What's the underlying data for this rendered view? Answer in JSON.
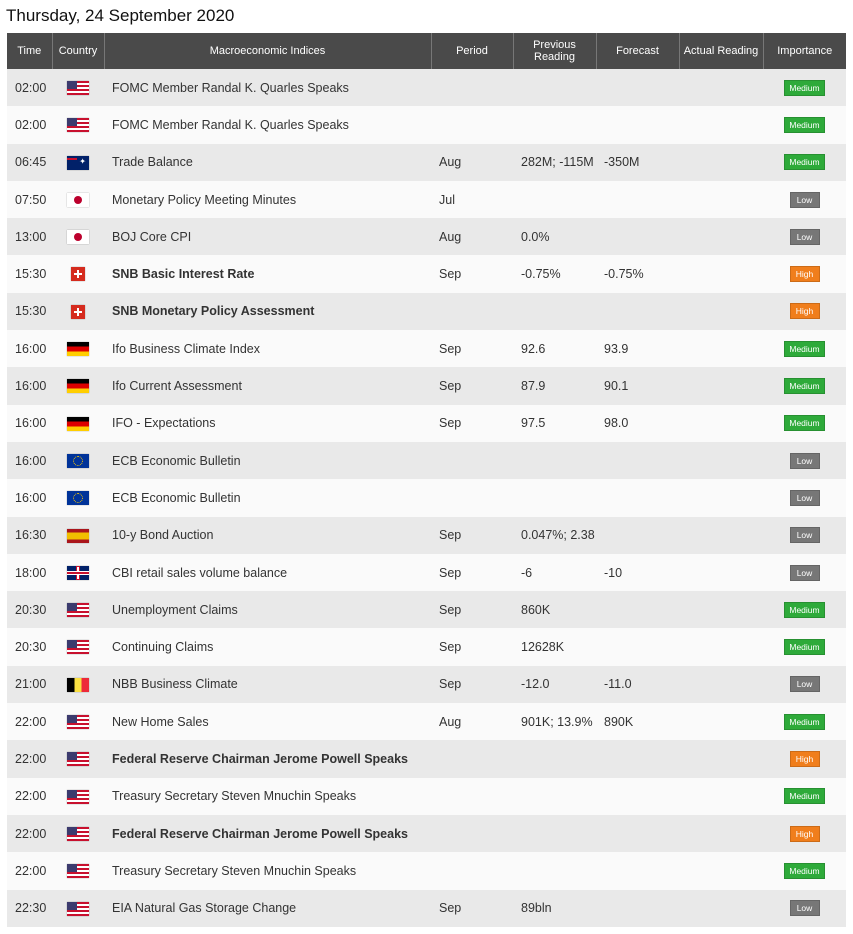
{
  "page_title": "Thursday, 24 September 2020",
  "headers": {
    "time": "Time",
    "country": "Country",
    "event": "Macroeconomic Indices",
    "period": "Period",
    "previous": "Previous Reading",
    "forecast": "Forecast",
    "actual": "Actual Reading",
    "importance": "Importance"
  },
  "importance_colors": {
    "Medium": "#2eaa3a",
    "Low": "#777777",
    "High": "#f07e1c"
  },
  "rows": [
    {
      "time": "02:00",
      "flag": "us-flag-icon",
      "event": "FOMC Member Randal K. Quarles Speaks",
      "bold": false,
      "period": "",
      "previous": "",
      "forecast": "",
      "actual": "",
      "importance": "Medium"
    },
    {
      "time": "02:00",
      "flag": "us-flag-icon",
      "event": "FOMC Member Randal K. Quarles Speaks",
      "bold": false,
      "period": "",
      "previous": "",
      "forecast": "",
      "actual": "",
      "importance": "Medium"
    },
    {
      "time": "06:45",
      "flag": "nz-flag-icon",
      "event": "Trade Balance",
      "bold": false,
      "period": "Aug",
      "previous": "282M; -115M",
      "forecast": "-350M",
      "actual": "",
      "importance": "Medium"
    },
    {
      "time": "07:50",
      "flag": "jp-flag-icon",
      "event": "Monetary Policy Meeting Minutes",
      "bold": false,
      "period": "Jul",
      "previous": "",
      "forecast": "",
      "actual": "",
      "importance": "Low"
    },
    {
      "time": "13:00",
      "flag": "jp-flag-icon",
      "event": "BOJ Core CPI",
      "bold": false,
      "period": "Aug",
      "previous": "0.0%",
      "forecast": "",
      "actual": "",
      "importance": "Low"
    },
    {
      "time": "15:30",
      "flag": "ch-flag-icon",
      "event": "SNB Basic Interest Rate",
      "bold": true,
      "period": "Sep",
      "previous": "-0.75%",
      "forecast": "-0.75%",
      "actual": "",
      "importance": "High"
    },
    {
      "time": "15:30",
      "flag": "ch-flag-icon",
      "event": "SNB Monetary Policy Assessment",
      "bold": true,
      "period": "",
      "previous": "",
      "forecast": "",
      "actual": "",
      "importance": "High"
    },
    {
      "time": "16:00",
      "flag": "de-flag-icon",
      "event": "Ifo Business Climate Index",
      "bold": false,
      "period": "Sep",
      "previous": "92.6",
      "forecast": "93.9",
      "actual": "",
      "importance": "Medium"
    },
    {
      "time": "16:00",
      "flag": "de-flag-icon",
      "event": "Ifo Current Assessment",
      "bold": false,
      "period": "Sep",
      "previous": "87.9",
      "forecast": "90.1",
      "actual": "",
      "importance": "Medium"
    },
    {
      "time": "16:00",
      "flag": "de-flag-icon",
      "event": "IFO - Expectations",
      "bold": false,
      "period": "Sep",
      "previous": "97.5",
      "forecast": "98.0",
      "actual": "",
      "importance": "Medium"
    },
    {
      "time": "16:00",
      "flag": "eu-flag-icon",
      "event": "ECB Economic Bulletin",
      "bold": false,
      "period": "",
      "previous": "",
      "forecast": "",
      "actual": "",
      "importance": "Low"
    },
    {
      "time": "16:00",
      "flag": "eu-flag-icon",
      "event": "ECB Economic Bulletin",
      "bold": false,
      "period": "",
      "previous": "",
      "forecast": "",
      "actual": "",
      "importance": "Low"
    },
    {
      "time": "16:30",
      "flag": "es-flag-icon",
      "event": "10-y Bond Auction",
      "bold": false,
      "period": "Sep",
      "previous": "0.047%; 2.38",
      "forecast": "",
      "actual": "",
      "importance": "Low"
    },
    {
      "time": "18:00",
      "flag": "uk-flag-icon",
      "event": "CBI retail sales volume balance",
      "bold": false,
      "period": "Sep",
      "previous": "-6",
      "forecast": "-10",
      "actual": "",
      "importance": "Low"
    },
    {
      "time": "20:30",
      "flag": "us-flag-icon",
      "event": "Unemployment Claims",
      "bold": false,
      "period": "Sep",
      "previous": "860K",
      "forecast": "",
      "actual": "",
      "importance": "Medium"
    },
    {
      "time": "20:30",
      "flag": "us-flag-icon",
      "event": "Continuing Claims",
      "bold": false,
      "period": "Sep",
      "previous": "12628K",
      "forecast": "",
      "actual": "",
      "importance": "Medium"
    },
    {
      "time": "21:00",
      "flag": "be-flag-icon",
      "event": "NBB Business Climate",
      "bold": false,
      "period": "Sep",
      "previous": "-12.0",
      "forecast": "-11.0",
      "actual": "",
      "importance": "Low"
    },
    {
      "time": "22:00",
      "flag": "us-flag-icon",
      "event": "New Home Sales",
      "bold": false,
      "period": "Aug",
      "previous": "901K; 13.9%",
      "forecast": "890K",
      "actual": "",
      "importance": "Medium"
    },
    {
      "time": "22:00",
      "flag": "us-flag-icon",
      "event": "Federal Reserve Chairman Jerome Powell Speaks",
      "bold": true,
      "period": "",
      "previous": "",
      "forecast": "",
      "actual": "",
      "importance": "High"
    },
    {
      "time": "22:00",
      "flag": "us-flag-icon",
      "event": "Treasury Secretary Steven Mnuchin Speaks",
      "bold": false,
      "period": "",
      "previous": "",
      "forecast": "",
      "actual": "",
      "importance": "Medium"
    },
    {
      "time": "22:00",
      "flag": "us-flag-icon",
      "event": "Federal Reserve Chairman Jerome Powell Speaks",
      "bold": true,
      "period": "",
      "previous": "",
      "forecast": "",
      "actual": "",
      "importance": "High"
    },
    {
      "time": "22:00",
      "flag": "us-flag-icon",
      "event": "Treasury Secretary Steven Mnuchin Speaks",
      "bold": false,
      "period": "",
      "previous": "",
      "forecast": "",
      "actual": "",
      "importance": "Medium"
    },
    {
      "time": "22:30",
      "flag": "us-flag-icon",
      "event": "EIA Natural Gas Storage Change",
      "bold": false,
      "period": "Sep",
      "previous": "89bln",
      "forecast": "",
      "actual": "",
      "importance": "Low"
    }
  ]
}
